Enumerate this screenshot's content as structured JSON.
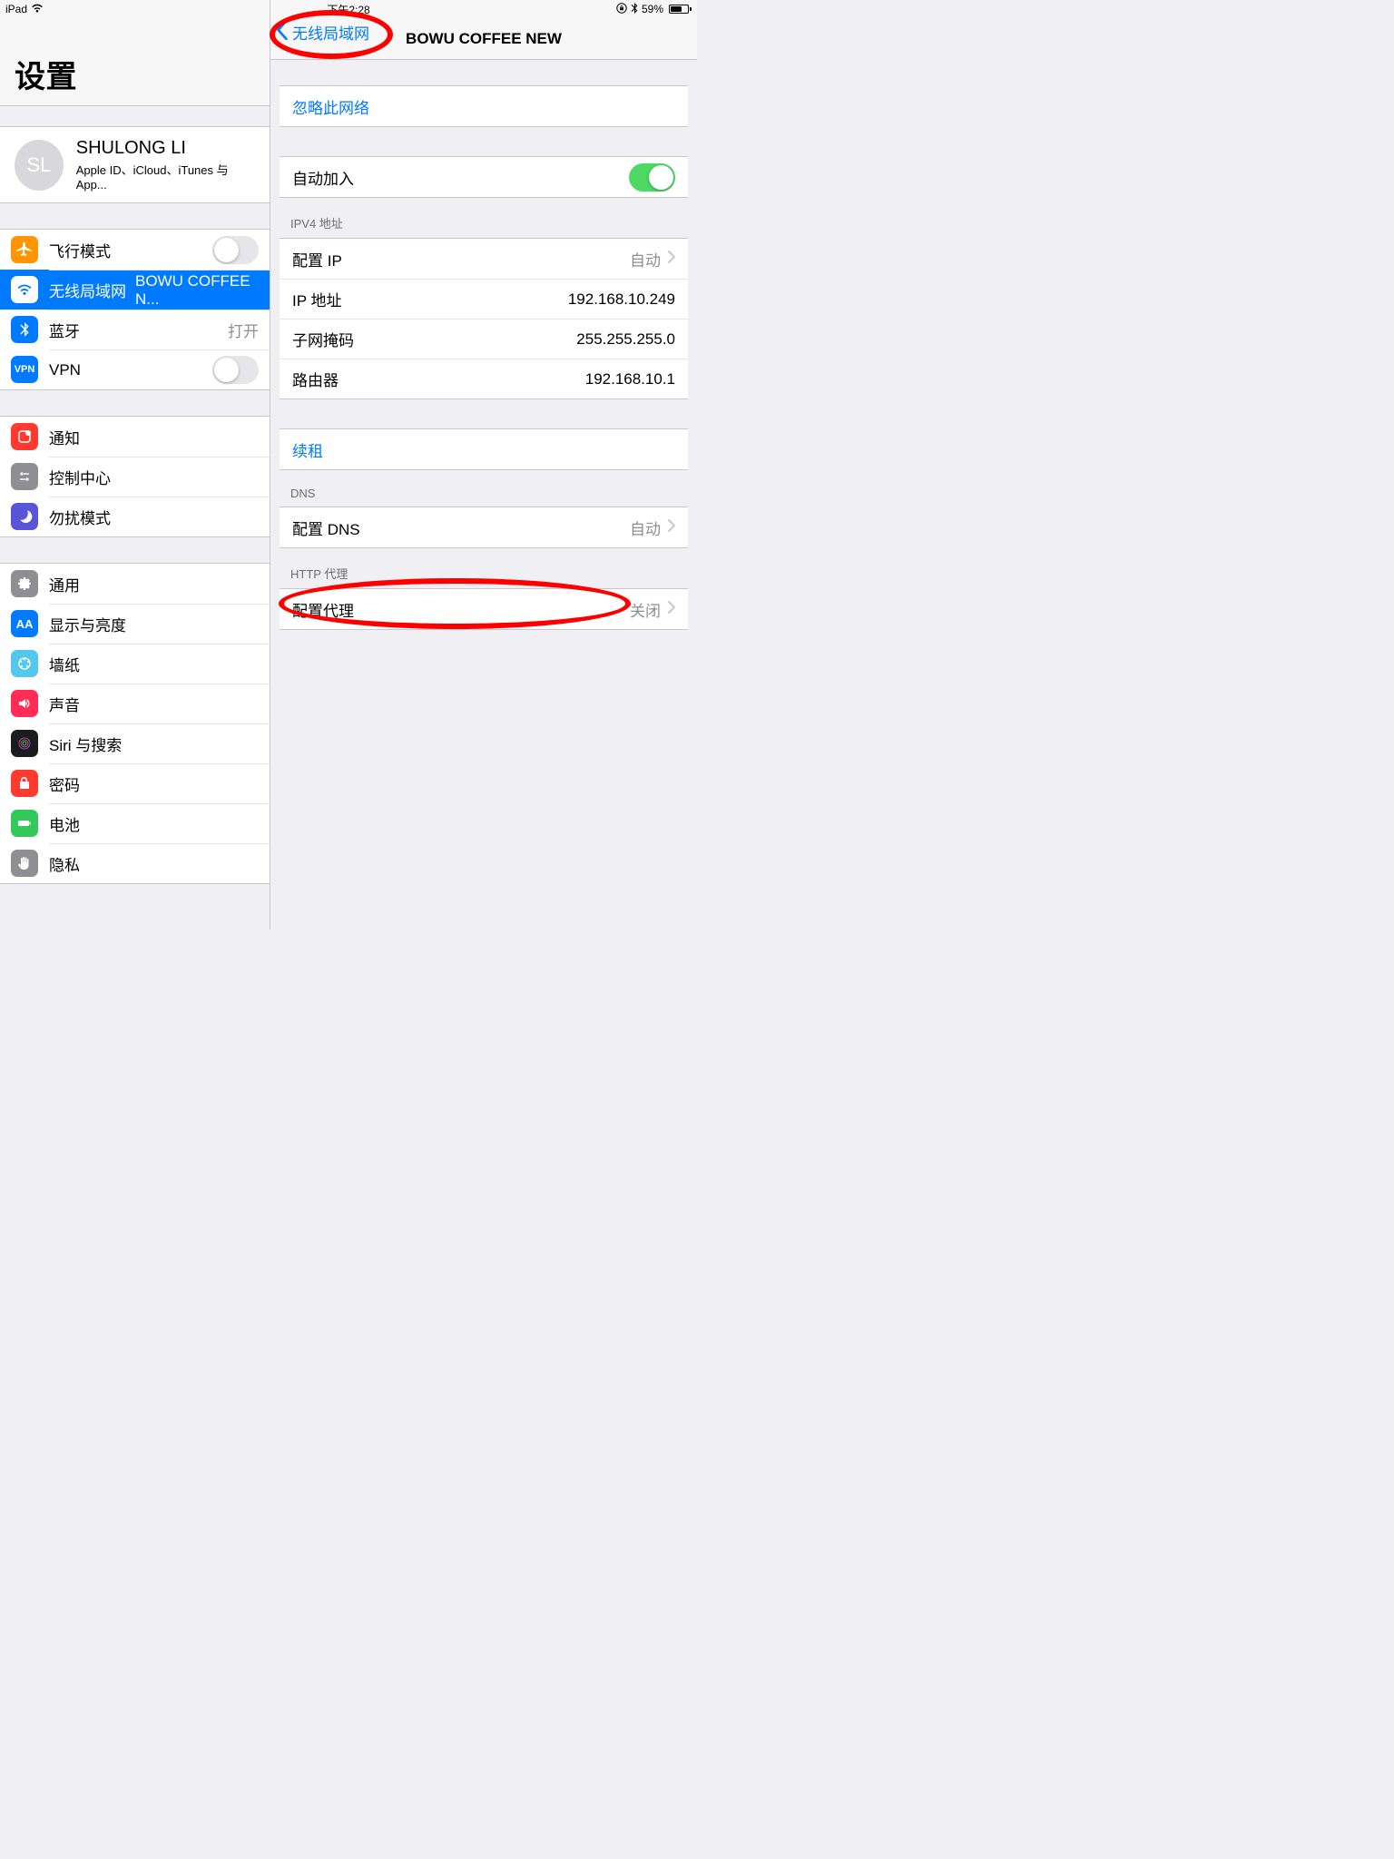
{
  "status": {
    "device": "iPad",
    "time": "下午2:28",
    "battery_pct": "59%"
  },
  "sidebar": {
    "title": "设置",
    "account": {
      "initials": "SL",
      "name": "SHULONG LI",
      "sub": "Apple ID、iCloud、iTunes 与 App..."
    },
    "g1": {
      "airplane": "飞行模式",
      "wifi": "无线局域网",
      "wifi_val": "BOWU COFFEE N...",
      "bt": "蓝牙",
      "bt_val": "打开",
      "vpn": "VPN"
    },
    "g2": {
      "notif": "通知",
      "control": "控制中心",
      "dnd": "勿扰模式"
    },
    "g3": {
      "general": "通用",
      "display": "显示与亮度",
      "wallpaper": "墙纸",
      "sound": "声音",
      "siri": "Siri 与搜索",
      "passcode": "密码",
      "battery": "电池",
      "privacy": "隐私"
    }
  },
  "detail": {
    "back": "无线局域网",
    "title": "BOWU COFFEE NEW",
    "forget": "忽略此网络",
    "autojoin": "自动加入",
    "ipv4_header": "IPV4 地址",
    "configure_ip": "配置 IP",
    "configure_ip_val": "自动",
    "ip_label": "IP 地址",
    "ip_val": "192.168.10.249",
    "subnet_label": "子网掩码",
    "subnet_val": "255.255.255.0",
    "router_label": "路由器",
    "router_val": "192.168.10.1",
    "renew": "续租",
    "dns_header": "DNS",
    "configure_dns": "配置 DNS",
    "configure_dns_val": "自动",
    "proxy_header": "HTTP 代理",
    "configure_proxy": "配置代理",
    "configure_proxy_val": "关闭"
  }
}
